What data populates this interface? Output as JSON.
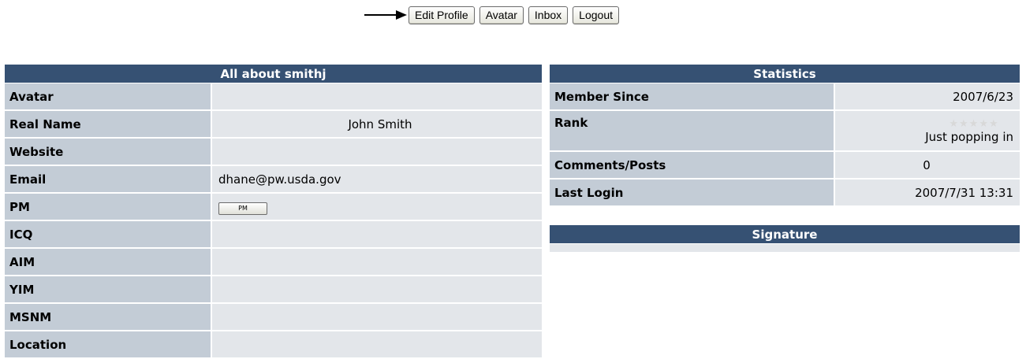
{
  "toolbar": {
    "buttons": [
      "Edit Profile",
      "Avatar",
      "Inbox",
      "Logout"
    ]
  },
  "profile": {
    "title": "All about smithj",
    "rows": [
      {
        "label": "Avatar",
        "value": ""
      },
      {
        "label": "Real Name",
        "value": "John Smith"
      },
      {
        "label": "Website",
        "value": ""
      },
      {
        "label": "Email",
        "value": "dhane@pw.usda.gov"
      },
      {
        "label": "PM",
        "value": "PM"
      },
      {
        "label": "ICQ",
        "value": ""
      },
      {
        "label": "AIM",
        "value": ""
      },
      {
        "label": "YIM",
        "value": ""
      },
      {
        "label": "MSNM",
        "value": ""
      },
      {
        "label": "Location",
        "value": ""
      }
    ]
  },
  "stats": {
    "title": "Statistics",
    "member_since_label": "Member Since",
    "member_since": "2007/6/23",
    "rank_label": "Rank",
    "rank_stars": "★★★★★",
    "rank_stars_filled": 0,
    "rank_title": "Just popping in",
    "comments_label": "Comments/Posts",
    "comments": "0",
    "last_login_label": "Last Login",
    "last_login": "2007/7/31 13:31"
  },
  "signature": {
    "title": "Signature",
    "value": ""
  },
  "icons": {
    "arrow": "arrow-right-icon",
    "star": "star-icon"
  },
  "colors": {
    "header_bg": "#365173",
    "label_bg": "#c3ccd6",
    "value_bg": "#e3e6ea"
  }
}
